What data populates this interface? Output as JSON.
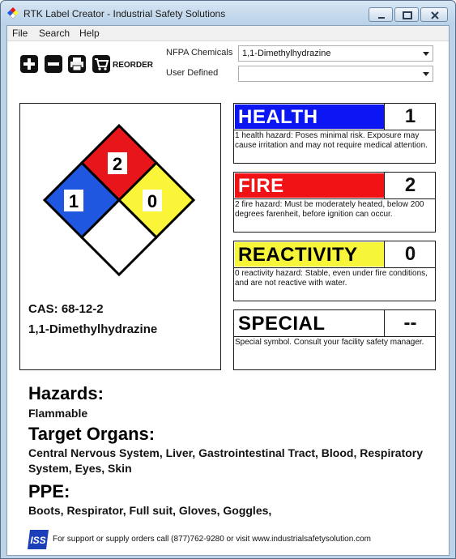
{
  "window": {
    "title": "RTK Label Creator - Industrial Safety Solutions"
  },
  "menu": [
    "File",
    "Search",
    "Help"
  ],
  "toolbar": {
    "reorder_label": "REORDER"
  },
  "fields": {
    "nfpa_label": "NFPA Chemicals",
    "nfpa_value": "1,1-Dimethylhydrazine",
    "user_defined_label": "User Defined",
    "user_defined_value": ""
  },
  "diamond": {
    "health": "1",
    "flammability": "2",
    "reactivity": "0",
    "special": "",
    "colors": {
      "health": "#1f57e0",
      "flammability": "#e8161b",
      "reactivity": "#fbf53a",
      "special": "#ffffff"
    }
  },
  "chemical": {
    "cas": "CAS: 68-12-2",
    "name": "1,1-Dimethylhydrazine"
  },
  "hazard_boxes": [
    {
      "key": "health",
      "title": "HEALTH",
      "value": "1",
      "color": "#0c16f2",
      "text_color": "#ffffff",
      "desc": "1 health hazard: Poses minimal risk. Exposure may cause irritation and may not require medical attention."
    },
    {
      "key": "fire",
      "title": "FIRE",
      "value": "2",
      "color": "#f01214",
      "text_color": "#ffffff",
      "desc": "2 fire hazard: Must be moderately heated, below 200 degrees farenheit, before ignition can occur."
    },
    {
      "key": "reactivity",
      "title": "REACTIVITY",
      "value": "0",
      "color": "#f7f53a",
      "text_color": "#000000",
      "desc": "0 reactivity hazard: Stable, even under fire conditions, and are not reactive with water."
    },
    {
      "key": "special",
      "title": "SPECIAL",
      "value": "--",
      "color": "#ffffff",
      "text_color": "#000000",
      "desc": "Special symbol. Consult your facility safety manager."
    }
  ],
  "sections": {
    "hazards_heading": "Hazards:",
    "hazards_value": "Flammable",
    "organs_heading": "Target Organs:",
    "organs_value": "Central Nervous System, Liver, Gastrointestinal Tract, Blood, Respiratory System, Eyes, Skin",
    "ppe_heading": "PPE:",
    "ppe_value": "Boots, Respirator, Full suit, Gloves, Goggles,"
  },
  "footer": {
    "logo_text": "ISS",
    "text": "For support or supply orders call (877)762-9280 or visit www.industrialsafetysolution.com"
  }
}
